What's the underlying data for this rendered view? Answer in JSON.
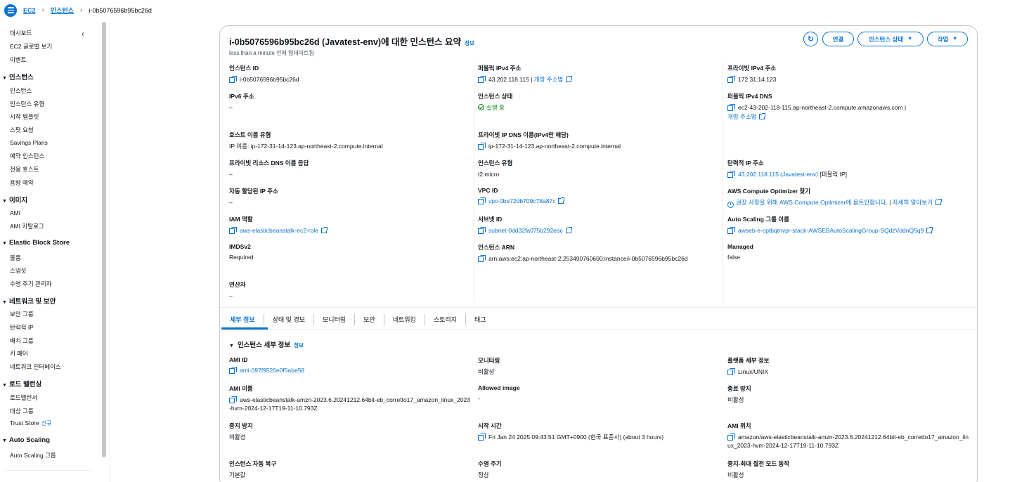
{
  "breadcrumb": {
    "service": "EC2",
    "section": "인스턴스",
    "current": "i-0b5076596b95bc26d"
  },
  "sidebar": {
    "items": {
      "dashboard": "대시보드",
      "global_view": "EC2 글로벌 보기",
      "events": "이벤트",
      "instances_head": "인스턴스",
      "instances": "인스턴스",
      "instance_types": "인스턴스 유형",
      "launch_templates": "시작 템플릿",
      "spot_requests": "스팟 요청",
      "savings_plans": "Savings Plans",
      "reserved_instances": "예약 인스턴스",
      "dedicated_hosts": "전용 호스트",
      "capacity_reservations": "용량 예약",
      "images_head": "이미지",
      "ami": "AMI",
      "ami_catalog": "AMI 카탈로그",
      "ebs_head": "Elastic Block Store",
      "volumes": "볼륨",
      "snapshots": "스냅샷",
      "lifecycle_manager": "수명 주기 관리자",
      "network_head": "네트워크 및 보안",
      "security_groups": "보안 그룹",
      "elastic_ips": "탄력적 IP",
      "placement_groups": "배치 그룹",
      "key_pairs": "키 페어",
      "network_interfaces": "네트워크 인터페이스",
      "lb_head": "로드 밸런싱",
      "load_balancers": "로드밸런서",
      "target_groups": "대상 그룹",
      "trust_stores": "Trust Store",
      "new_badge": "신규",
      "as_head": "Auto Scaling",
      "as_groups": "Auto Scaling 그룹"
    }
  },
  "summary": {
    "title": "i-0b5076596b95bc26d (Javatest-env)에 대한 인스턴스 요약",
    "info": "정보",
    "updated": "less than a minute 전에 업데이트됨",
    "buttons": {
      "connect": "연결",
      "state": "인스턴스 상태",
      "actions": "작업"
    },
    "col1": {
      "instance_id_label": "인스턴스 ID",
      "instance_id": "i-0b5076596b95bc26d",
      "ipv6_label": "IPv6 주소",
      "ipv6": "–",
      "hostname_type_label": "호스트 이름 유형",
      "hostname_type": "IP 이름: ip-172-31-14-123.ap-northeast-2.compute.internal",
      "private_dns_answer_label": "프라이빗 리소스 DNS 이름 응답",
      "private_dns_answer": "–",
      "auto_ip_label": "자동 할당된 IP 주소",
      "auto_ip": "–",
      "iam_label": "IAM 역할",
      "iam": "aws-elasticbeanstalk-ec2-role",
      "imds_label": "IMDSv2",
      "imds": "Required",
      "operator_label": "연산자",
      "operator": "–"
    },
    "col2": {
      "public_ipv4_label": "퍼블릭 IPv4 주소",
      "public_ipv4": "43.202.118.115",
      "open_address": "개방 주소법",
      "state_label": "인스턴스 상태",
      "state": "실행 중",
      "private_dns_label": "프라이빗 IP DNS 이름(IPv4만 해당)",
      "private_dns": "ip-172-31-14-123.ap-northeast-2.compute.internal",
      "type_label": "인스턴스 유형",
      "type": "t2.micro",
      "vpc_label": "VPC ID",
      "vpc": "vpc-0be72db709c78a87c",
      "subnet_label": "서브넷 ID",
      "subnet": "subnet-0dd32fa075b292eac",
      "arn_label": "인스턴스 ARN",
      "arn": "arn:aws:ec2:ap-northeast-2:253490760600:instance/i-0b5076596b95bc26d"
    },
    "col3": {
      "private_ipv4_label": "프라이빗 IPv4 주소",
      "private_ipv4": "172.31.14.123",
      "public_dns_label": "퍼블릭 IPv4 DNS",
      "public_dns": "ec2-43-202-118-115.ap-northeast-2.compute.amazonaws.com",
      "open_address": "개방 주소법",
      "eip_label": "탄력적 IP 주소",
      "eip": "43.202.118.115 (Javatest-env)",
      "eip_suffix": "[퍼블릭 IP]",
      "optimizer_label": "AWS Compute Optimizer 찾기",
      "optimizer": "권장 사항을 위해 AWS Compute Optimizer에 옵트인합니다.",
      "learn_more": "자세히 알아보기",
      "asg_label": "Auto Scaling 그룹 이름",
      "asg": "awseb-e-cptbqtnvpr-stack-AWSEBAutoScalingGroup-SQdzVddnQ5q9",
      "managed_label": "Managed",
      "managed": "false"
    }
  },
  "tabs": [
    "세부 정보",
    "상태 및 경보",
    "모니터링",
    "보안",
    "네트워킹",
    "스토리지",
    "태그"
  ],
  "details": {
    "section_title": "인스턴스 세부 정보",
    "info": "정보",
    "col1": {
      "ami_id_label": "AMI ID",
      "ami_id": "ami-097f9520e0f5abe58",
      "ami_name_label": "AMI 이름",
      "ami_name": "aws-elasticbeanstalk-amzn-2023.6.20241212.64bit-eb_corretto17_amazon_linux_2023-hvm-2024-12-17T19-11-10.793Z",
      "stop_protect_label": "중지 방지",
      "stop_protect": "비활성",
      "auto_recovery_label": "인스턴스 자동 복구",
      "auto_recovery": "기본값"
    },
    "col2": {
      "monitoring_label": "모니터링",
      "monitoring": "비활성",
      "allowed_image_label": "Allowed image",
      "allowed_image": "-",
      "launch_time_label": "시작 시간",
      "launch_time": "Fri Jan 24 2025 09:43:51 GMT+0900 (한국 표준시) (about 3 hours)",
      "lifecycle_label": "수명 주기",
      "lifecycle": "정상"
    },
    "col3": {
      "platform_label": "플랫폼 세부 정보",
      "platform": "Linux/UNIX",
      "termination_label": "종료 방지",
      "termination": "비활성",
      "ami_location_label": "AMI 위치",
      "ami_location": "amazon/aws-elasticbeanstalk-amzn-2023.6.20241212.64bit-eb_corretto17_amazon_linux_2023-hvm-2024-12-17T19-11-10.793Z",
      "stop_hibernate_label": "중지-최대 절전 모드 동작",
      "stop_hibernate": "비활성"
    }
  }
}
